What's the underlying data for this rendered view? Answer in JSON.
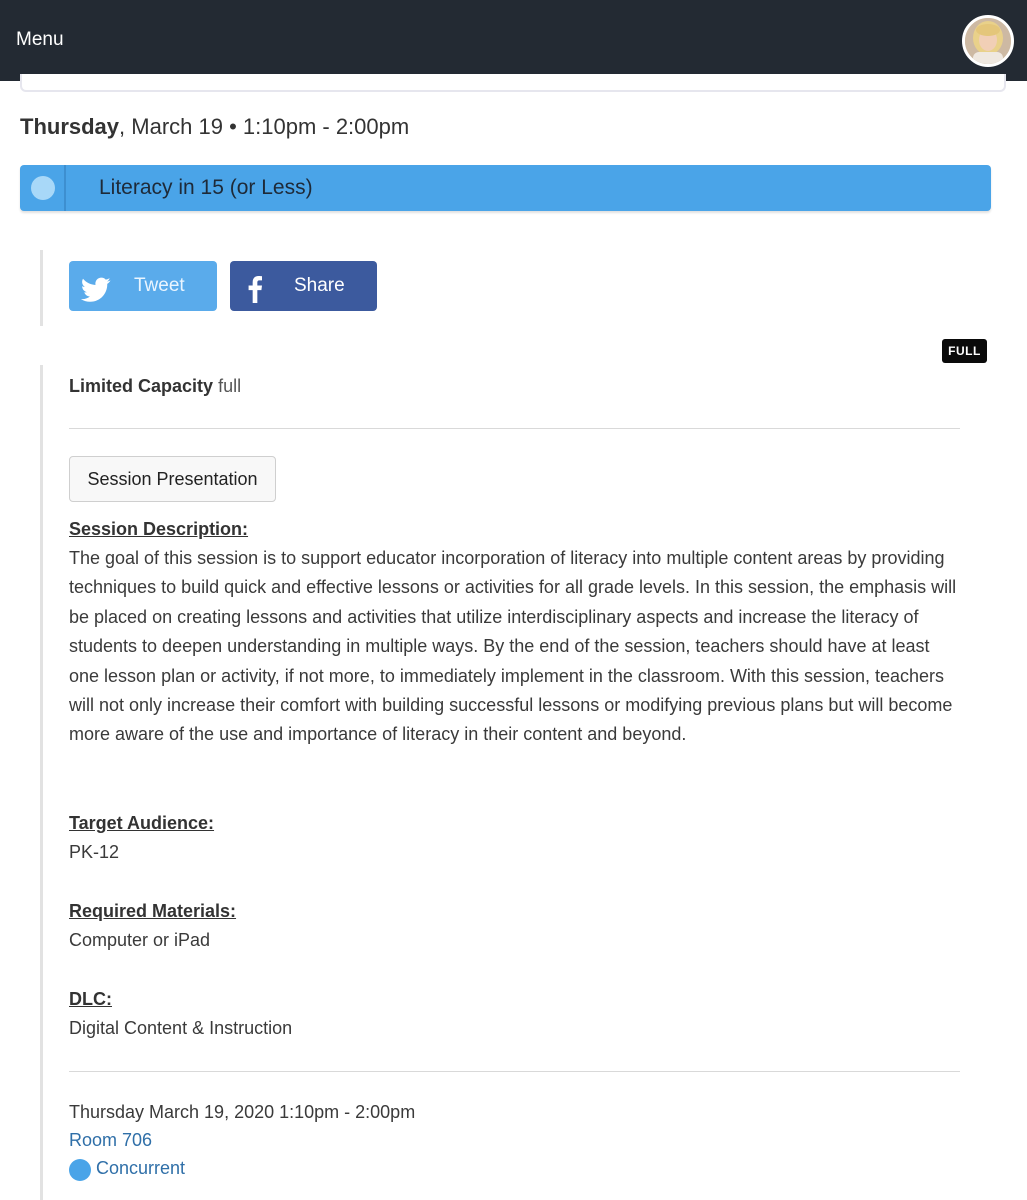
{
  "nav": {
    "menu_label": "Menu"
  },
  "session": {
    "day": "Thursday",
    "date_rest": ", March 19 • 1:10pm - 2:00pm",
    "title": "Literacy in 15 (or Less)",
    "status_badge": "FULL"
  },
  "social": {
    "tweet_label": "Tweet",
    "share_label": "Share"
  },
  "capacity": {
    "label": "Limited Capacity",
    "value": "full"
  },
  "presentation_button": "Session Presentation",
  "description": {
    "label": "Session Description:",
    "text": "The goal of this session is to support educator incorporation of literacy into multiple content areas by providing techniques to build quick and effective lessons or activities for all grade levels. In this session, the emphasis will be placed on creating lessons and activities that utilize interdisciplinary aspects and increase the literacy of students to deepen understanding in multiple ways. By the end of the session, teachers should have at least one lesson plan or activity, if not more, to immediately implement in the classroom. With this session, teachers will not only increase their comfort with building successful lessons or modifying previous plans but will become more aware of the use and importance of literacy in their content and beyond."
  },
  "target_audience": {
    "label": "Target Audience:",
    "value": "PK-12"
  },
  "required_materials": {
    "label": "Required Materials:",
    "value": "Computer or iPad"
  },
  "dlc": {
    "label": "DLC:",
    "value": "Digital Content & Instruction"
  },
  "footer": {
    "datetime": "Thursday March 19, 2020 1:10pm - 2:00pm",
    "room": "Room 706",
    "type": "Concurrent"
  },
  "colors": {
    "nav_bg": "#232a33",
    "session_blue": "#4aa4e8",
    "twitter": "#5aabeb",
    "facebook": "#3c5a9e",
    "link": "#2f6fa8"
  },
  "icons": [
    "twitter-icon",
    "facebook-icon",
    "session-color-dot",
    "avatar"
  ]
}
